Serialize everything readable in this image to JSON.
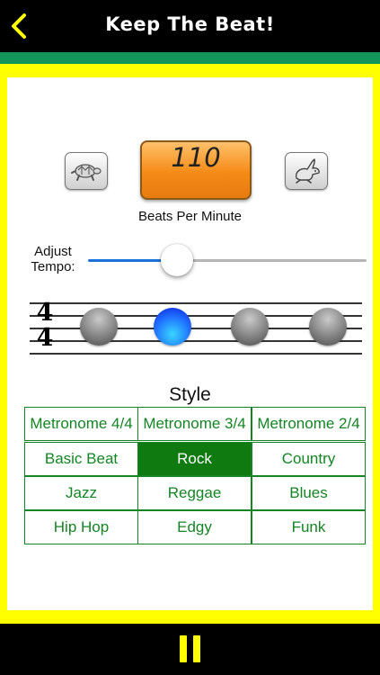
{
  "header": {
    "title": "Keep The Beat!",
    "back_icon": "chevron-left-icon"
  },
  "colors": {
    "accent": "#ffff00",
    "strip": "#13955a",
    "grid_green": "#148424",
    "selected_green": "#0f7a10",
    "bpm_orange": "#f58a16",
    "active_beat": "#1f6fff"
  },
  "tempo": {
    "bpm": "110",
    "bpm_label": "Beats Per Minute",
    "slower_icon": "turtle-icon",
    "faster_icon": "rabbit-icon",
    "adjust_label": "Adjust Tempo:",
    "slider_fraction": 0.32
  },
  "staff": {
    "time_signature_top": "4",
    "time_signature_bottom": "4",
    "beats": 4,
    "active_beat": 2
  },
  "style": {
    "title": "Style",
    "options": [
      [
        "Metronome 4/4",
        "Metronome 3/4",
        "Metronome 2/4"
      ],
      [
        "Basic Beat",
        "Rock",
        "Country"
      ],
      [
        "Jazz",
        "Reggae",
        "Blues"
      ],
      [
        "Hip Hop",
        "Edgy",
        "Funk"
      ]
    ],
    "selected": "Rock"
  },
  "footer": {
    "pause_icon": "pause-icon"
  }
}
